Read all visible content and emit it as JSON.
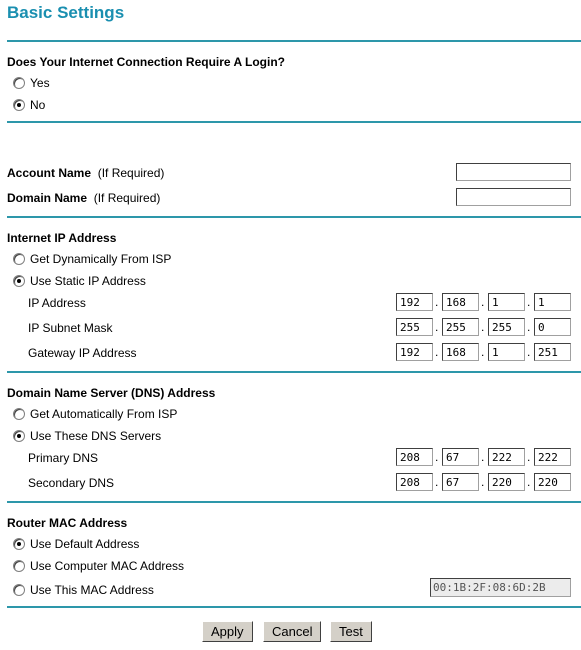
{
  "page": {
    "title": "Basic Settings"
  },
  "login": {
    "question": "Does Your Internet Connection Require A Login?",
    "options": [
      {
        "label": "Yes",
        "selected": false
      },
      {
        "label": "No",
        "selected": true
      }
    ]
  },
  "account": {
    "account_name_label": "Account Name",
    "domain_name_label": "Domain Name",
    "if_required": "(If Required)",
    "account_name_value": "",
    "domain_name_value": ""
  },
  "internet_ip": {
    "heading": "Internet IP Address",
    "options": [
      {
        "label": "Get Dynamically From ISP",
        "selected": false
      },
      {
        "label": "Use Static IP Address",
        "selected": true
      }
    ],
    "fields": [
      {
        "label": "IP Address",
        "octets": [
          "192",
          "168",
          "1",
          "1"
        ]
      },
      {
        "label": "IP Subnet Mask",
        "octets": [
          "255",
          "255",
          "255",
          "0"
        ]
      },
      {
        "label": "Gateway IP Address",
        "octets": [
          "192",
          "168",
          "1",
          "251"
        ]
      }
    ]
  },
  "dns": {
    "heading": "Domain Name Server (DNS) Address",
    "options": [
      {
        "label": "Get Automatically From ISP",
        "selected": false
      },
      {
        "label": "Use These DNS Servers",
        "selected": true
      }
    ],
    "fields": [
      {
        "label": "Primary DNS",
        "octets": [
          "208",
          "67",
          "222",
          "222"
        ]
      },
      {
        "label": "Secondary DNS",
        "octets": [
          "208",
          "67",
          "220",
          "220"
        ]
      }
    ]
  },
  "mac": {
    "heading": "Router MAC Address",
    "options": [
      {
        "label": "Use Default Address",
        "selected": true
      },
      {
        "label": "Use Computer MAC Address",
        "selected": false
      },
      {
        "label": "Use This MAC Address",
        "selected": false
      }
    ],
    "value": "00:1B:2F:08:6D:2B"
  },
  "buttons": {
    "apply": "Apply",
    "cancel": "Cancel",
    "test": "Test"
  },
  "colors": {
    "accent": "#1a8fb0",
    "rule": "#2d97aa"
  }
}
